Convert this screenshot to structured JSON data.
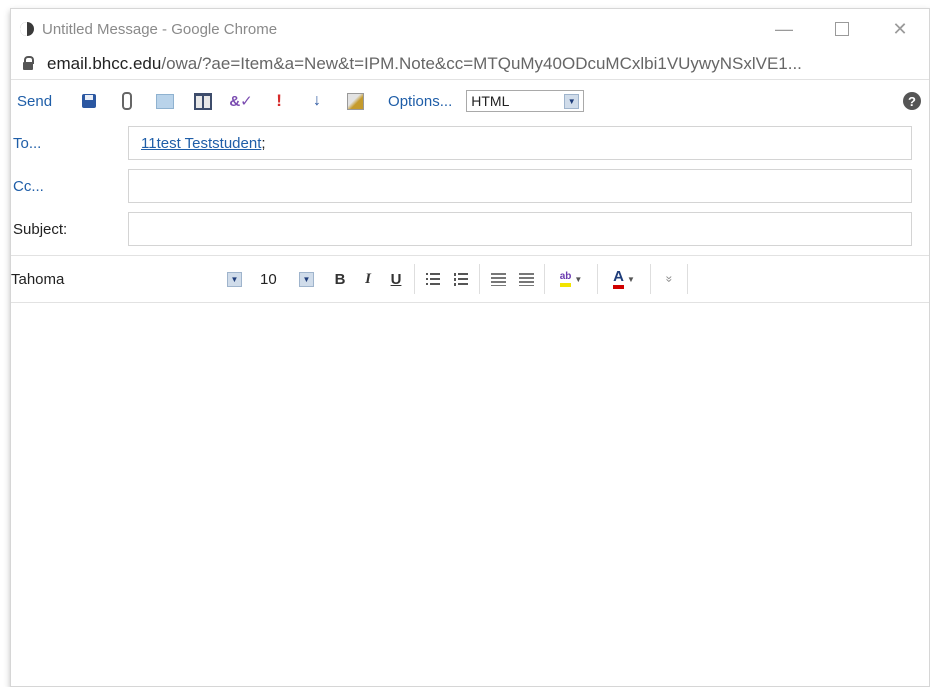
{
  "window": {
    "title": "Untitled Message - Google Chrome",
    "minimize_glyph": "—",
    "close_glyph": "✕"
  },
  "address": {
    "host": "email.bhcc.edu",
    "path": "/owa/?ae=Item&a=New&t=IPM.Note&cc=MTQuMy40ODcuMCxlbi1VUywyNSxlVE1..."
  },
  "toolbar": {
    "send_label": "Send",
    "options_label": "Options...",
    "format_value": "HTML",
    "help_glyph": "?"
  },
  "fields": {
    "to_label": "To...",
    "to_recipient": "11test Teststudent",
    "to_separator": ";",
    "cc_label": "Cc...",
    "cc_value": "",
    "subject_label": "Subject:",
    "subject_value": ""
  },
  "format_bar": {
    "font_name": "Tahoma",
    "font_size": "10",
    "bold": "B",
    "italic": "I",
    "underline": "U",
    "highlight_glyph": "ab",
    "font_color_glyph": "A",
    "more_glyph": "»"
  },
  "colors": {
    "link": "#1f5ea8",
    "highlight": "#f2e400",
    "font_color": "#d00000"
  }
}
